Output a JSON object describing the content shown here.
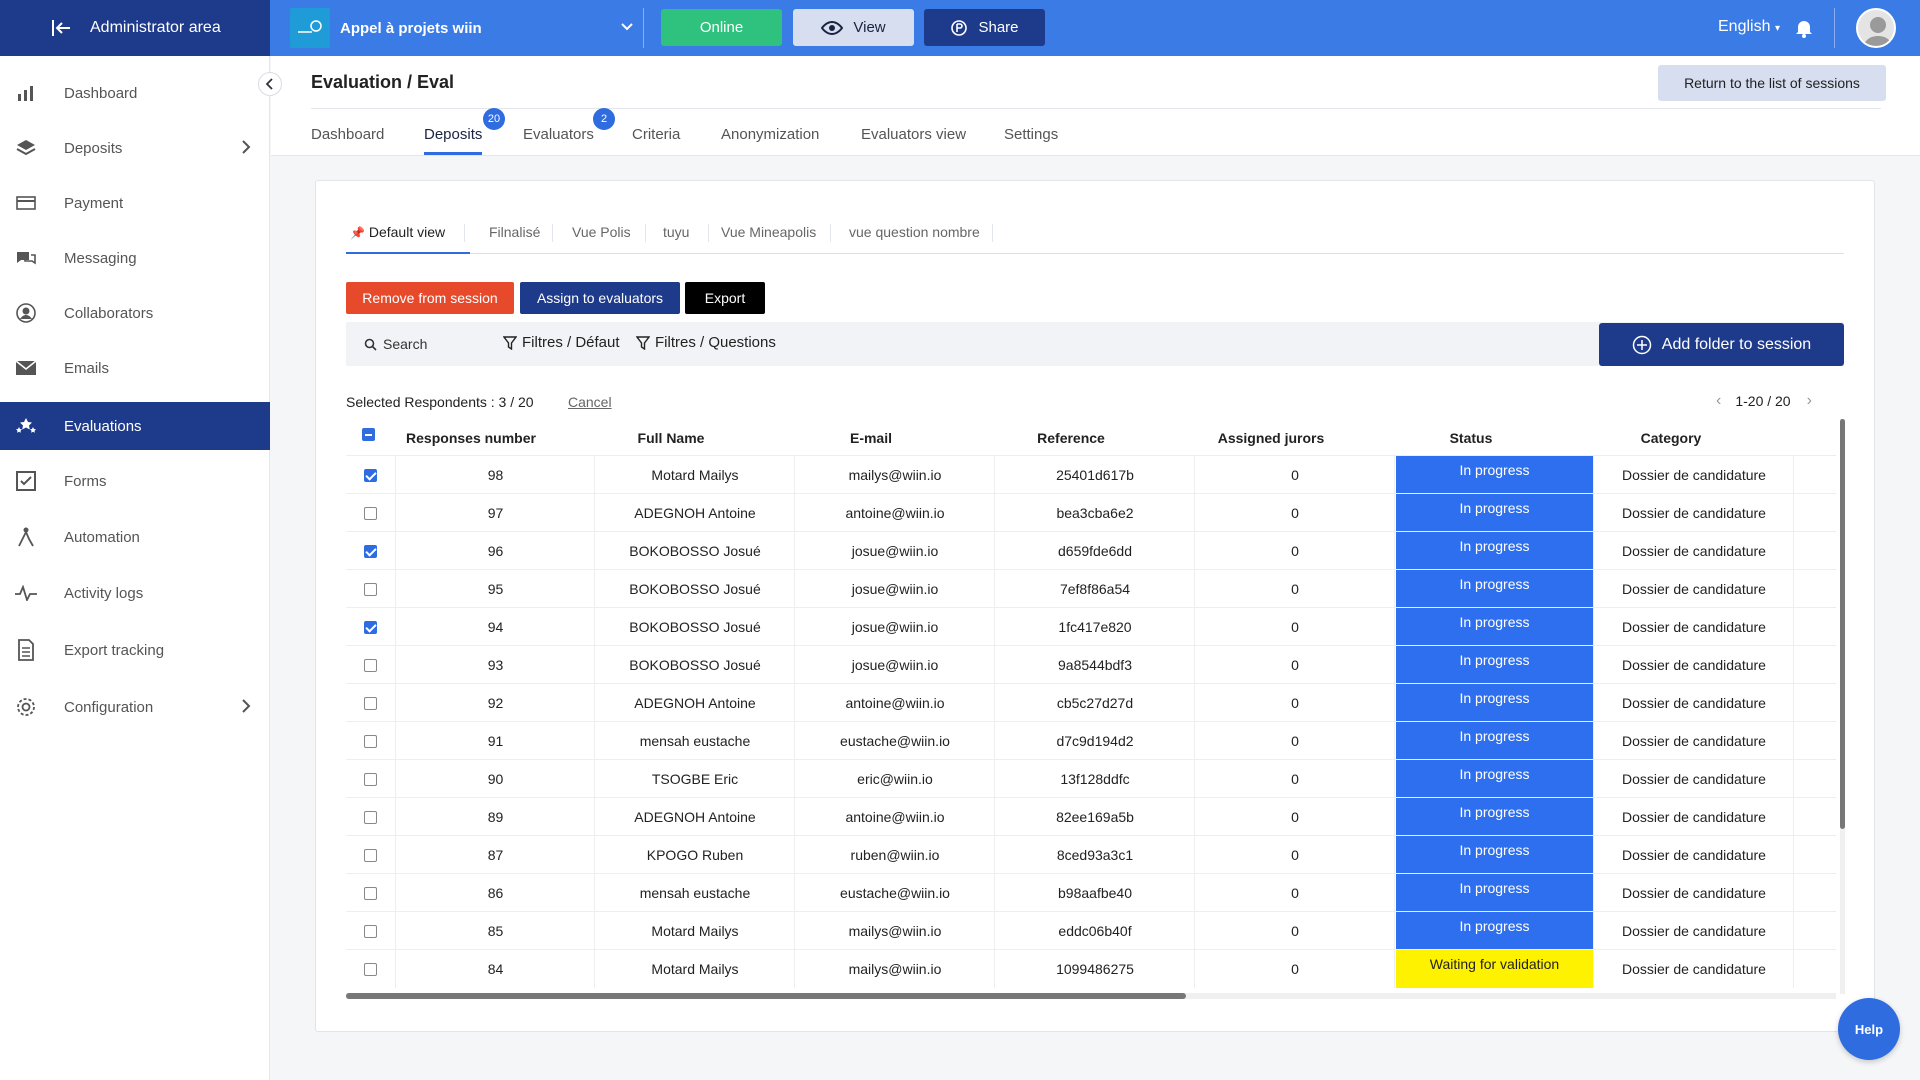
{
  "topbar": {
    "admin_label": "Administrator area",
    "project_name": "Appel à projets wiin",
    "online_label": "Online",
    "view_label": "View",
    "share_label": "Share",
    "language": "English",
    "colors": {
      "bar": "#3a7be6",
      "admin_bg": "#1e3a8a",
      "online": "#2ec27e"
    }
  },
  "sidebar": {
    "items": [
      {
        "label": "Dashboard",
        "icon": "bar-chart-icon"
      },
      {
        "label": "Deposits",
        "icon": "layers-icon",
        "has_arrow": true
      },
      {
        "label": "Payment",
        "icon": "card-icon"
      },
      {
        "label": "Messaging",
        "icon": "chat-icon"
      },
      {
        "label": "Collaborators",
        "icon": "user-circle-icon"
      },
      {
        "label": "Emails",
        "icon": "envelope-icon"
      },
      {
        "label": "Evaluations",
        "icon": "stars-icon",
        "active": true
      },
      {
        "label": "Forms",
        "icon": "checkbox-icon"
      },
      {
        "label": "Automation",
        "icon": "automation-icon"
      },
      {
        "label": "Activity logs",
        "icon": "pulse-icon"
      },
      {
        "label": "Export tracking",
        "icon": "document-icon"
      },
      {
        "label": "Configuration",
        "icon": "gear-icon",
        "has_arrow": true
      }
    ]
  },
  "header": {
    "title": "Evaluation / Eval",
    "return_label": "Return to the list of sessions",
    "tabs": [
      {
        "label": "Dashboard"
      },
      {
        "label": "Deposits",
        "badge": "20",
        "active": true
      },
      {
        "label": "Evaluators",
        "badge": "2"
      },
      {
        "label": "Criteria"
      },
      {
        "label": "Anonymization"
      },
      {
        "label": "Evaluators view"
      },
      {
        "label": "Settings"
      }
    ]
  },
  "views": {
    "tabs": [
      "Default view",
      "Filnalisé",
      "Vue Polis",
      "tuyu",
      "Vue Mineapolis",
      "vue question nombre"
    ]
  },
  "actions": {
    "remove": "Remove from session",
    "assign": "Assign to evaluators",
    "export": "Export",
    "search": "Search",
    "filter_default": "Filtres / Défaut",
    "filter_questions": "Filtres / Questions",
    "add_folder": "Add folder to session"
  },
  "selection": {
    "info": "Selected Respondents : 3 / 20",
    "cancel": "Cancel",
    "pager": "1-20 / 20"
  },
  "table": {
    "headers": [
      "Responses number",
      "Full Name",
      "E-mail",
      "Reference",
      "Assigned jurors",
      "Status",
      "Category"
    ],
    "rows": [
      {
        "checked": true,
        "num": "98",
        "name": "Motard Mailys",
        "email": "mailys@wiin.io",
        "ref": "25401d617b",
        "jurors": "0",
        "status": "In progress",
        "status_type": "progress",
        "category": "Dossier de candidature"
      },
      {
        "checked": false,
        "num": "97",
        "name": "ADEGNOH Antoine",
        "email": "antoine@wiin.io",
        "ref": "bea3cba6e2",
        "jurors": "0",
        "status": "In progress",
        "status_type": "progress",
        "category": "Dossier de candidature"
      },
      {
        "checked": true,
        "num": "96",
        "name": "BOKOBOSSO Josué",
        "email": "josue@wiin.io",
        "ref": "d659fde6dd",
        "jurors": "0",
        "status": "In progress",
        "status_type": "progress",
        "category": "Dossier de candidature"
      },
      {
        "checked": false,
        "num": "95",
        "name": "BOKOBOSSO Josué",
        "email": "josue@wiin.io",
        "ref": "7ef8f86a54",
        "jurors": "0",
        "status": "In progress",
        "status_type": "progress",
        "category": "Dossier de candidature"
      },
      {
        "checked": true,
        "num": "94",
        "name": "BOKOBOSSO Josué",
        "email": "josue@wiin.io",
        "ref": "1fc417e820",
        "jurors": "0",
        "status": "In progress",
        "status_type": "progress",
        "category": "Dossier de candidature"
      },
      {
        "checked": false,
        "num": "93",
        "name": "BOKOBOSSO Josué",
        "email": "josue@wiin.io",
        "ref": "9a8544bdf3",
        "jurors": "0",
        "status": "In progress",
        "status_type": "progress",
        "category": "Dossier de candidature"
      },
      {
        "checked": false,
        "num": "92",
        "name": "ADEGNOH Antoine",
        "email": "antoine@wiin.io",
        "ref": "cb5c27d27d",
        "jurors": "0",
        "status": "In progress",
        "status_type": "progress",
        "category": "Dossier de candidature"
      },
      {
        "checked": false,
        "num": "91",
        "name": "mensah eustache",
        "email": "eustache@wiin.io",
        "ref": "d7c9d194d2",
        "jurors": "0",
        "status": "In progress",
        "status_type": "progress",
        "category": "Dossier de candidature"
      },
      {
        "checked": false,
        "num": "90",
        "name": "TSOGBE Eric",
        "email": "eric@wiin.io",
        "ref": "13f128ddfc",
        "jurors": "0",
        "status": "In progress",
        "status_type": "progress",
        "category": "Dossier de candidature"
      },
      {
        "checked": false,
        "num": "89",
        "name": "ADEGNOH Antoine",
        "email": "antoine@wiin.io",
        "ref": "82ee169a5b",
        "jurors": "0",
        "status": "In progress",
        "status_type": "progress",
        "category": "Dossier de candidature"
      },
      {
        "checked": false,
        "num": "87",
        "name": "KPOGO Ruben",
        "email": "ruben@wiin.io",
        "ref": "8ced93a3c1",
        "jurors": "0",
        "status": "In progress",
        "status_type": "progress",
        "category": "Dossier de candidature"
      },
      {
        "checked": false,
        "num": "86",
        "name": "mensah eustache",
        "email": "eustache@wiin.io",
        "ref": "b98aafbe40",
        "jurors": "0",
        "status": "In progress",
        "status_type": "progress",
        "category": "Dossier de candidature"
      },
      {
        "checked": false,
        "num": "85",
        "name": "Motard Mailys",
        "email": "mailys@wiin.io",
        "ref": "eddc06b40f",
        "jurors": "0",
        "status": "In progress",
        "status_type": "progress",
        "category": "Dossier de candidature"
      },
      {
        "checked": false,
        "num": "84",
        "name": "Motard Mailys",
        "email": "mailys@wiin.io",
        "ref": "1099486275",
        "jurors": "0",
        "status": "Waiting for validation",
        "status_type": "waiting",
        "category": "Dossier de candidature"
      }
    ]
  },
  "help_label": "Help"
}
